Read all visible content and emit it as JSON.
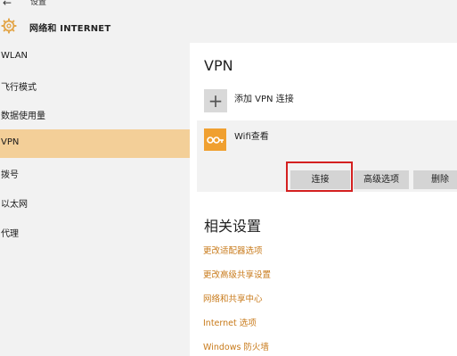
{
  "window": {
    "title": "设置",
    "back_glyph": "←"
  },
  "header": {
    "title": "网络和 INTERNET"
  },
  "sidebar": {
    "items": [
      {
        "label": "WLAN",
        "active": false
      },
      {
        "label": "飞行模式",
        "active": false
      },
      {
        "label": "数据使用量",
        "active": false
      },
      {
        "label": "VPN",
        "active": true
      },
      {
        "label": "拨号",
        "active": false
      },
      {
        "label": "以太网",
        "active": false
      },
      {
        "label": "代理",
        "active": false
      }
    ]
  },
  "main": {
    "title": "VPN",
    "add_vpn": {
      "icon_glyph": "+",
      "label": "添加 VPN 连接"
    },
    "connection": {
      "name": "Wifi查看",
      "buttons": {
        "connect": "连接",
        "advanced": "高级选项",
        "delete": "删除"
      }
    },
    "related": {
      "title": "相关设置",
      "links": [
        "更改适配器选项",
        "更改高级共享设置",
        "网络和共享中心",
        "Internet 选项",
        "Windows 防火墙"
      ]
    }
  },
  "colors": {
    "accent": "#f3cf98",
    "link": "#c87a1a",
    "highlight_border": "#d42020",
    "logo": "#f0a030"
  },
  "icons": [
    "back-arrow-icon",
    "gear-icon",
    "plus-icon",
    "vpn-logo-icon"
  ]
}
